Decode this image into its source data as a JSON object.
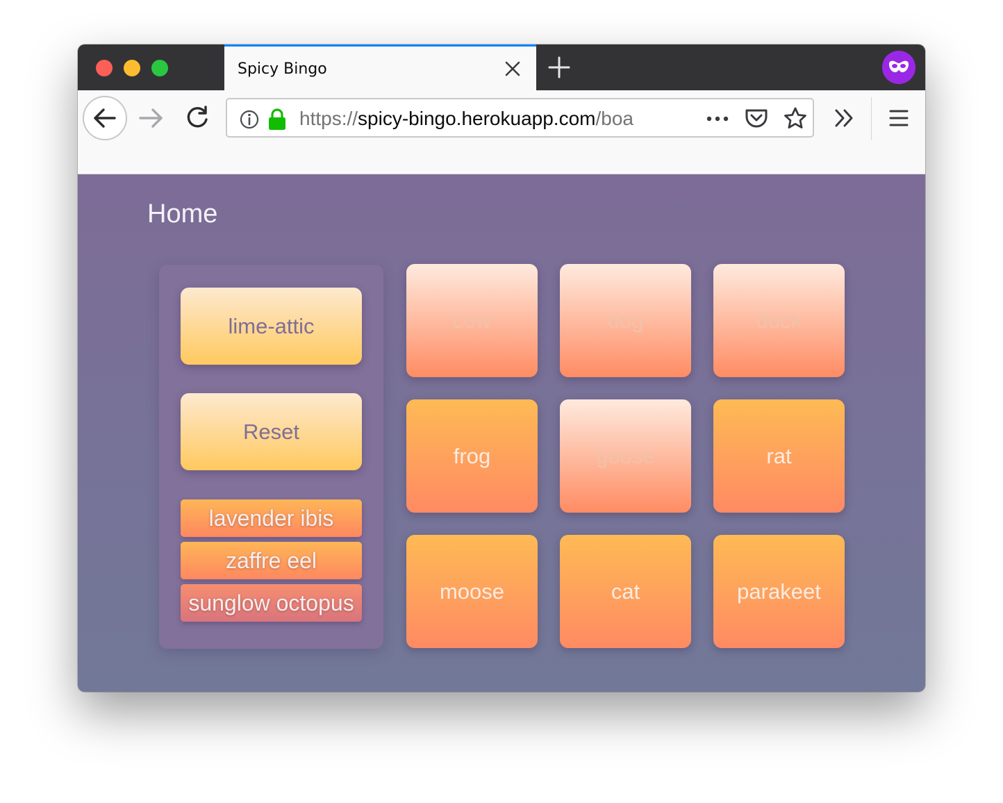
{
  "browser": {
    "tab": {
      "title": "Spicy Bingo"
    },
    "url": {
      "protocol": "https://",
      "host": "spicy-bingo.herokuapp.com",
      "path": "/boa"
    }
  },
  "page": {
    "home_label": "Home",
    "side_panel": {
      "board_button_label": "lime-attic",
      "reset_button_label": "Reset",
      "players": [
        {
          "name": "lavender ibis",
          "color": "#fea25b"
        },
        {
          "name": "zaffre eel",
          "color": "#fe9a5c"
        },
        {
          "name": "sunglow octopus",
          "color": "#e57f78"
        }
      ]
    },
    "squares": [
      {
        "label": "cow",
        "checked": false
      },
      {
        "label": "dog",
        "checked": false
      },
      {
        "label": "duck",
        "checked": false
      },
      {
        "label": "frog",
        "checked": true
      },
      {
        "label": "goose",
        "checked": false
      },
      {
        "label": "rat",
        "checked": true
      },
      {
        "label": "moose",
        "checked": true
      },
      {
        "label": "cat",
        "checked": true
      },
      {
        "label": "parakeet",
        "checked": true
      }
    ]
  },
  "colors": {
    "background": "#7a7398",
    "accent_tab": "#0a84ff",
    "unchecked_top": "#feeade",
    "checked_top": "#feba55",
    "square_bottom": "#ff8a63",
    "private_badge": "#9b27e6"
  },
  "icons": [
    "close-icon",
    "plus-icon",
    "private-browsing-icon",
    "back-arrow-icon",
    "forward-arrow-icon",
    "reload-icon",
    "info-icon",
    "lock-icon",
    "more-icon",
    "pocket-icon",
    "star-icon",
    "overflow-icon",
    "menu-icon"
  ]
}
